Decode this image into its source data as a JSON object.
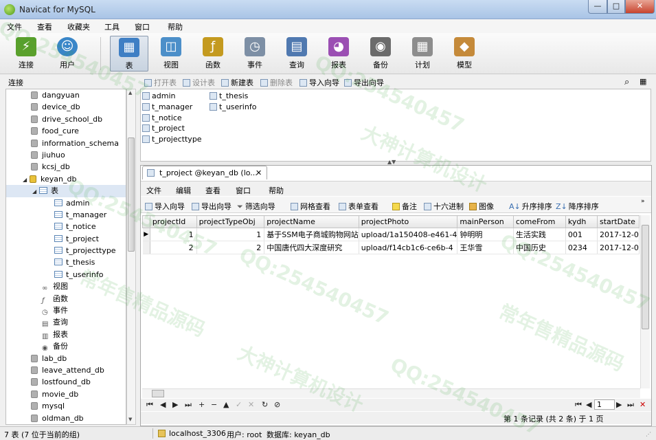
{
  "window": {
    "title": "Navicat for MySQL",
    "minimize": "—",
    "maximize": "□",
    "close": "✕"
  },
  "menu": [
    "文件",
    "查看",
    "收藏夹",
    "工具",
    "窗口",
    "帮助"
  ],
  "toolbar": [
    {
      "label": "连接",
      "icon": "connection-icon",
      "color": "#5aa02c"
    },
    {
      "label": "用户",
      "icon": "user-icon",
      "color": "#3a86c8"
    },
    {
      "label": "表",
      "icon": "table-icon",
      "color": "#3f7fc4"
    },
    {
      "label": "视图",
      "icon": "view-icon",
      "color": "#4c8fc9"
    },
    {
      "label": "函数",
      "icon": "function-icon",
      "color": "#c49a1f"
    },
    {
      "label": "事件",
      "icon": "event-icon",
      "color": "#7d8fa5"
    },
    {
      "label": "查询",
      "icon": "query-icon",
      "color": "#5079b0"
    },
    {
      "label": "报表",
      "icon": "report-icon",
      "color": "#9b4fb3"
    },
    {
      "label": "备份",
      "icon": "backup-icon",
      "color": "#6b6b6b"
    },
    {
      "label": "计划",
      "icon": "schedule-icon",
      "color": "#8d8d8d"
    },
    {
      "label": "模型",
      "icon": "model-icon",
      "color": "#c58a3a"
    }
  ],
  "connection_label": "连接",
  "object_toolbar": {
    "open": "打开表",
    "design": "设计表",
    "new": "新建表",
    "delete": "删除表",
    "import": "导入向导",
    "export": "导出向导"
  },
  "tree": {
    "databases_before": [
      "dangyuan",
      "device_db",
      "drive_school_db",
      "food_cure",
      "information_schema",
      "jiuhuo",
      "kcsj_db"
    ],
    "open_db": "keyan_db",
    "tables_node": "表",
    "tables": [
      "admin",
      "t_manager",
      "t_notice",
      "t_project",
      "t_projecttype",
      "t_thesis",
      "t_userinfo"
    ],
    "sub_nodes": [
      "视图",
      "函数",
      "事件",
      "查询",
      "报表",
      "备份"
    ],
    "databases_after": [
      "lab_db",
      "leave_attend_db",
      "lostfound_db",
      "movie_db",
      "mysql",
      "oldman_db"
    ]
  },
  "objects": {
    "col1": [
      "admin",
      "t_manager",
      "t_notice",
      "t_project",
      "t_projecttype"
    ],
    "col2": [
      "t_thesis",
      "t_userinfo"
    ]
  },
  "tab": {
    "title": "t_project @keyan_db (lo...",
    "close": "✕"
  },
  "inner_menu": [
    "文件",
    "编辑",
    "查看",
    "窗口",
    "帮助"
  ],
  "inner_toolbar": [
    "导入向导",
    "导出向导",
    "筛选向导",
    "网格查看",
    "表单查看",
    "备注",
    "十六进制",
    "图像",
    "升序排序",
    "降序排序"
  ],
  "grid": {
    "columns": [
      "projectId",
      "projectTypeObj",
      "projectName",
      "projectPhoto",
      "mainPerson",
      "comeFrom",
      "kydh",
      "startDate"
    ],
    "rows": [
      [
        "1",
        "1",
        "基于SSM电子商城购物网站",
        "upload/1a150408-e461-4",
        "钟明明",
        "生活实践",
        "001",
        "2017-12-0"
      ],
      [
        "2",
        "2",
        "中国唐代四大深度研究",
        "upload/f14cb1c6-ce6b-4",
        "王华雪",
        "中国历史",
        "0234",
        "2017-12-0"
      ]
    ]
  },
  "navbar": {
    "page": "1",
    "buttons": [
      "⏮",
      "◀",
      "▶",
      "⏭",
      "+",
      "−",
      "▲",
      "✓",
      "✕",
      "↻",
      "⊘"
    ]
  },
  "record_info": "第 1 条记录 (共 2 条) 于 1 页",
  "status": {
    "left": "7 表 (7 位于当前的组)",
    "connection": "localhost_3306",
    "user": "用户: root",
    "database": "数据库: keyan_db"
  },
  "watermarks": [
    "QQ:254540457",
    "大神计算机设计",
    "常年售精品源码"
  ]
}
